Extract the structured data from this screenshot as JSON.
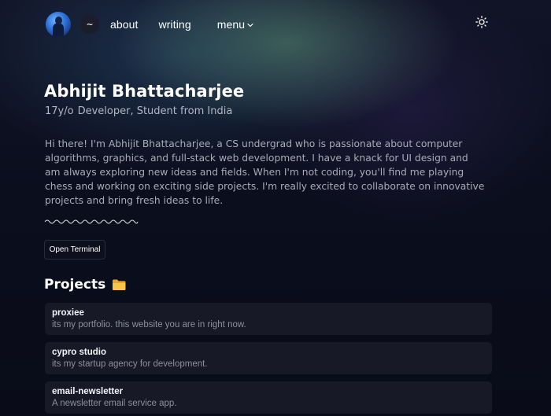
{
  "nav": {
    "home_label": "~",
    "links": [
      {
        "label": "about"
      },
      {
        "label": "writing"
      },
      {
        "label": "menu"
      }
    ],
    "menu_icon": "chevron-down-icon",
    "theme_icon": "sun-icon"
  },
  "hero": {
    "name": "Abhijit Bhattacharjee",
    "age": "17y/o",
    "role": "Developer, Student from India",
    "bio": "Hi there! I'm Abhijit Bhattacharjee, a CS undergrad who is passionate about computer algorithms, graphics, and full-stack web development. I have a knack for UI design and am always exploring new ideas and fields. When I'm not coding, you'll find me playing chess and working on exciting side projects. I'm really excited to collaborate on innovative projects and bring fresh ideas to life.",
    "terminal_button": "Open Terminal"
  },
  "projects": {
    "heading": "Projects",
    "heading_icon": "folder-icon",
    "items": [
      {
        "title": "proxiee",
        "description": "its my portfolio. this website you are in right now."
      },
      {
        "title": "cypro studio",
        "description": "its my startup agency for development."
      },
      {
        "title": "email-newsletter",
        "description": "A newsletter email service app."
      }
    ]
  },
  "colors": {
    "background": "#0a0c1a",
    "card": "#171927",
    "text": "#ffffff",
    "muted": "#a9abb7"
  }
}
